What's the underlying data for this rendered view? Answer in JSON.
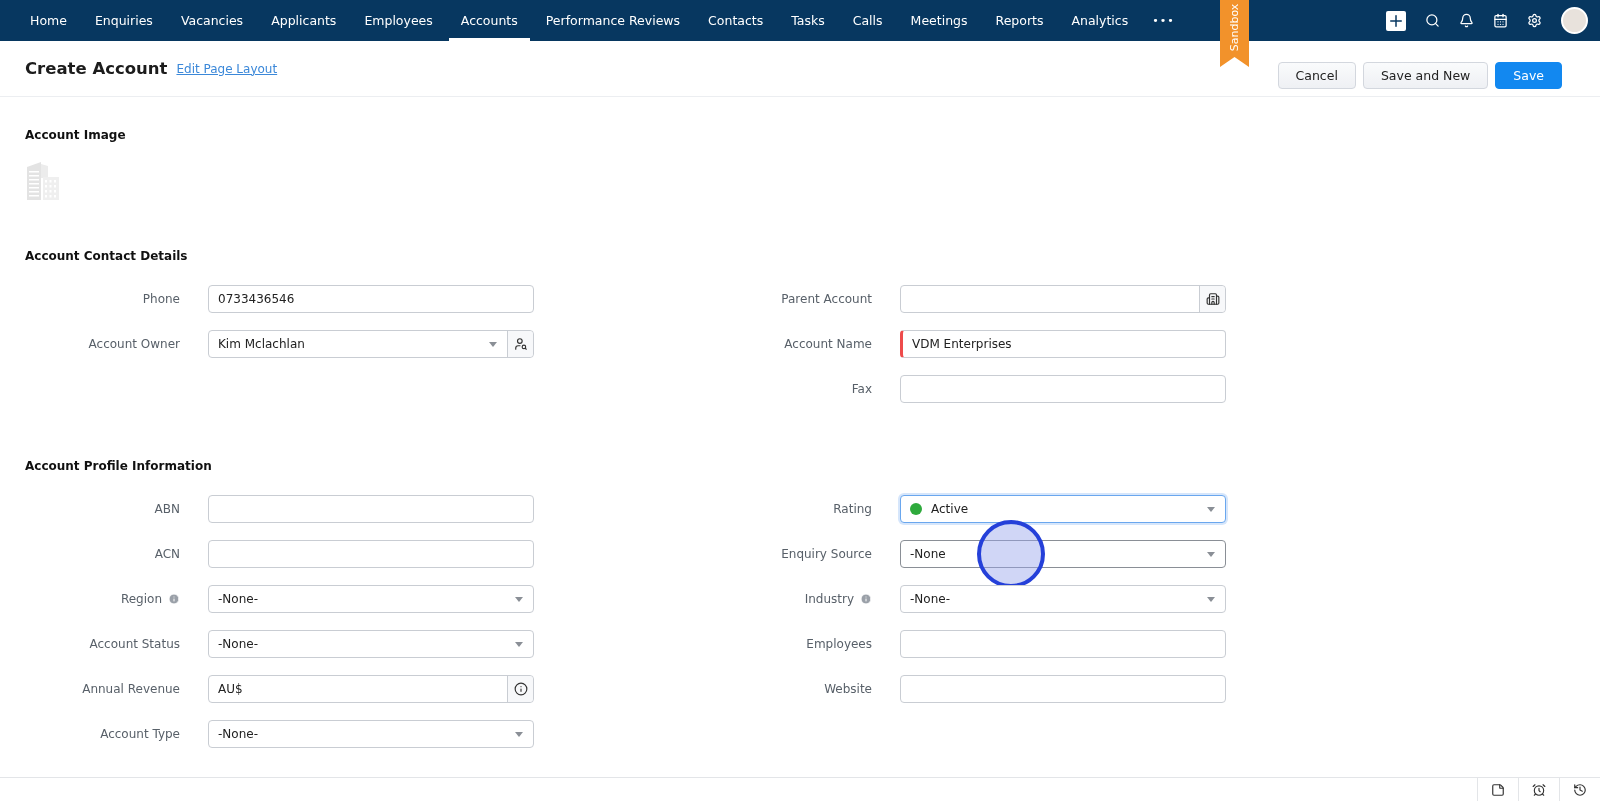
{
  "nav": {
    "items": [
      {
        "label": "Home",
        "selected": false
      },
      {
        "label": "Enquiries",
        "selected": false
      },
      {
        "label": "Vacancies",
        "selected": false
      },
      {
        "label": "Applicants",
        "selected": false
      },
      {
        "label": "Employees",
        "selected": false
      },
      {
        "label": "Accounts",
        "selected": true
      },
      {
        "label": "Performance Reviews",
        "selected": false
      },
      {
        "label": "Contacts",
        "selected": false
      },
      {
        "label": "Tasks",
        "selected": false
      },
      {
        "label": "Calls",
        "selected": false
      },
      {
        "label": "Meetings",
        "selected": false
      },
      {
        "label": "Reports",
        "selected": false
      },
      {
        "label": "Analytics",
        "selected": false
      }
    ],
    "more": "•••",
    "ribbon": "Sandbox"
  },
  "header": {
    "title": "Create Account",
    "link": "Edit Page Layout",
    "buttons": [
      {
        "label": "Cancel",
        "kind": "secondary"
      },
      {
        "label": "Save and New",
        "kind": "secondary"
      },
      {
        "label": "Save",
        "kind": "primary"
      }
    ]
  },
  "sections": [
    {
      "title": "Account Image",
      "kind": "image"
    },
    {
      "title": "Account Contact Details",
      "kind": "fields",
      "left": [
        {
          "label": "Phone",
          "kind": "text",
          "value": "0733436546"
        },
        {
          "label": "Account Owner",
          "kind": "lookup",
          "value": "Kim Mclachlan"
        }
      ],
      "right": [
        {
          "label": "Parent Account",
          "kind": "building-lookup"
        },
        {
          "label": "Account Name",
          "kind": "text",
          "value": "VDM Enterprises",
          "required": true
        },
        {
          "label": "Fax",
          "kind": "text"
        }
      ]
    },
    {
      "title": "Account Profile Information",
      "kind": "fields",
      "left": [
        {
          "label": "ABN",
          "kind": "text"
        },
        {
          "label": "ACN",
          "kind": "text"
        },
        {
          "label": "Region",
          "kind": "select",
          "value": "-None-",
          "info": true
        },
        {
          "label": "Account Status",
          "kind": "select",
          "value": "-None-"
        },
        {
          "label": "Annual Revenue",
          "kind": "currency",
          "value": "AU$"
        },
        {
          "label": "Account Type",
          "kind": "select",
          "value": "-None-"
        }
      ],
      "right": [
        {
          "label": "Rating",
          "kind": "select",
          "value": "Active",
          "color": "#2eaa3c",
          "focused": true
        },
        {
          "label": "Enquiry Source",
          "kind": "select",
          "value": "-None",
          "hovered": true,
          "clicked": true
        },
        {
          "label": "Industry",
          "kind": "select",
          "value": "-None-",
          "info": true
        },
        {
          "label": "Employees",
          "kind": "text"
        },
        {
          "label": "Website",
          "kind": "text"
        }
      ]
    }
  ]
}
